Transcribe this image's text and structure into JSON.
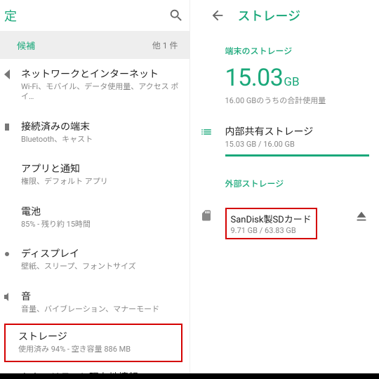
{
  "left": {
    "title_partial": "定",
    "suggest": {
      "label": "候補",
      "more": "他 1 件"
    },
    "items": [
      {
        "title": "ネットワークとインターネット",
        "sub": "Wi-Fi、モバイル、データ使用量、アクセス ポイ…"
      },
      {
        "title": "接続済みの端末",
        "sub": "Bluetooth、キャスト"
      },
      {
        "title": "アプリと通知",
        "sub": "権限、デフォルト アプリ"
      },
      {
        "title": "電池",
        "sub": "85% - 残り約 15時間"
      },
      {
        "title": "ディスプレイ",
        "sub": "壁紙、スリープ、フォントサイズ"
      },
      {
        "title": "音",
        "sub": "音量、バイブレーション、マナーモード"
      },
      {
        "title": "ストレージ",
        "sub": "使用済み 94% - 空き容量 886 MB",
        "boxed": true
      },
      {
        "title": "セキュリティと現在地情報",
        "sub": ""
      }
    ]
  },
  "right": {
    "title": "ストレージ",
    "device_section": "端末のストレージ",
    "big_value": "15.03",
    "big_unit": "GB",
    "big_sub": "16.00 GBのうちの合計使用量",
    "internal": {
      "title": "内部共有ストレージ",
      "sub": "15.03 GB / 16.00 GB"
    },
    "external_section": "外部ストレージ",
    "external": {
      "title": "SanDisk製SDカード",
      "sub": "9.71 GB / 63.83 GB"
    }
  }
}
